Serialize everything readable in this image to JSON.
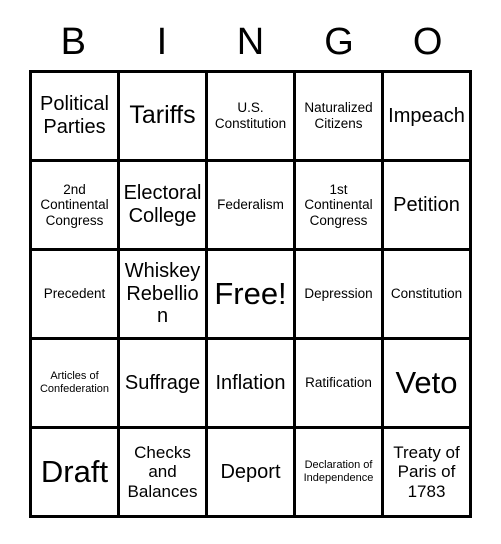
{
  "card": {
    "title": "BINGO Card",
    "header_letters": [
      "B",
      "I",
      "N",
      "G",
      "O"
    ],
    "grid_size": 5,
    "border_color": "#000000",
    "background_color": "#ffffff",
    "text_color": "#000000",
    "rows": [
      [
        {
          "text": "Political Parties",
          "size": "lg"
        },
        {
          "text": "Tariffs",
          "size": "xl"
        },
        {
          "text": "U.S. Constitution",
          "size": "sm"
        },
        {
          "text": "Naturalized Citizens",
          "size": "sm"
        },
        {
          "text": "Impeach",
          "size": "lg"
        }
      ],
      [
        {
          "text": "2nd Continental Congress",
          "size": "sm"
        },
        {
          "text": "Electoral College",
          "size": "lg"
        },
        {
          "text": "Federalism",
          "size": "sm"
        },
        {
          "text": "1st Continental Congress",
          "size": "sm"
        },
        {
          "text": "Petition",
          "size": "lg"
        }
      ],
      [
        {
          "text": "Precedent",
          "size": "sm"
        },
        {
          "text": "Whiskey Rebellion",
          "size": "lg"
        },
        {
          "text": "Free!",
          "size": "xxl"
        },
        {
          "text": "Depression",
          "size": "sm"
        },
        {
          "text": "Constitution",
          "size": "sm"
        }
      ],
      [
        {
          "text": "Articles of Confederation",
          "size": "xs"
        },
        {
          "text": "Suffrage",
          "size": "lg"
        },
        {
          "text": "Inflation",
          "size": "lg"
        },
        {
          "text": "Ratification",
          "size": "sm"
        },
        {
          "text": "Veto",
          "size": "xxl"
        }
      ],
      [
        {
          "text": "Draft",
          "size": "xxl"
        },
        {
          "text": "Checks and Balances",
          "size": "md"
        },
        {
          "text": "Deport",
          "size": "lg"
        },
        {
          "text": "Declaration of Independence",
          "size": "xs"
        },
        {
          "text": "Treaty of Paris of 1783",
          "size": "md"
        }
      ]
    ]
  }
}
